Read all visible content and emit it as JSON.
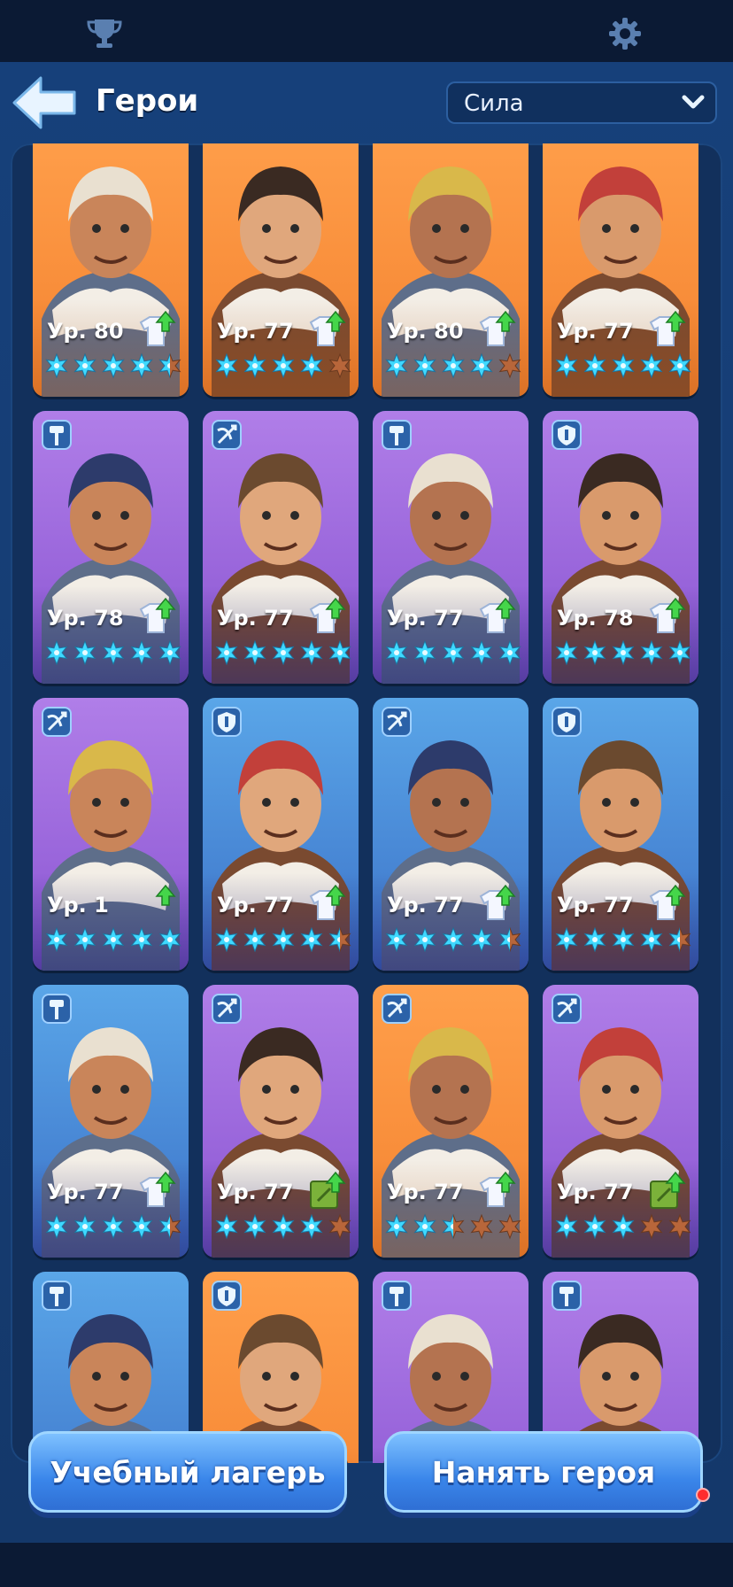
{
  "nav": {
    "trophy_icon": "trophy-icon",
    "settings_icon": "gear-icon"
  },
  "header": {
    "title": "Герои",
    "back_icon": "back-arrow-icon"
  },
  "sort": {
    "selected": "Сила",
    "icon": "chevron-down-icon"
  },
  "roles": {
    "melee": "hammer-icon",
    "ranged": "crossbow-icon",
    "tank": "shield-icon"
  },
  "colors": {
    "orange": "#f48330",
    "purple": "#8a55d2",
    "blue": "#3c72c8",
    "star_active": "#3fd9ff",
    "star_inactive": "#b8663a",
    "accent": "#3a86ea"
  },
  "heroes": [
    {
      "level": "Ур. 80",
      "frame": "orange",
      "role": "",
      "stars_filled": 4.5,
      "upgrade": "shirt"
    },
    {
      "level": "Ур. 77",
      "frame": "orange",
      "role": "",
      "stars_filled": 4,
      "upgrade": "shirt"
    },
    {
      "level": "Ур. 80",
      "frame": "orange",
      "role": "",
      "stars_filled": 4,
      "upgrade": "shirt"
    },
    {
      "level": "Ур. 77",
      "frame": "orange",
      "role": "",
      "stars_filled": 5,
      "upgrade": "shirt"
    },
    {
      "level": "Ур. 78",
      "frame": "purple",
      "role": "melee",
      "stars_filled": 5,
      "upgrade": "shirt"
    },
    {
      "level": "Ур. 77",
      "frame": "purple",
      "role": "ranged",
      "stars_filled": 5,
      "upgrade": "shirt"
    },
    {
      "level": "Ур. 77",
      "frame": "purple",
      "role": "melee",
      "stars_filled": 5,
      "upgrade": "shirt"
    },
    {
      "level": "Ур. 78",
      "frame": "purple",
      "role": "tank",
      "stars_filled": 5,
      "upgrade": "shirt"
    },
    {
      "level": "Ур. 1",
      "frame": "purple",
      "role": "ranged",
      "stars_filled": 5,
      "upgrade": "arrow"
    },
    {
      "level": "Ур. 77",
      "frame": "blue",
      "role": "tank",
      "stars_filled": 4.5,
      "upgrade": "shirt"
    },
    {
      "level": "Ур. 77",
      "frame": "blue",
      "role": "ranged",
      "stars_filled": 4.5,
      "upgrade": "shirt"
    },
    {
      "level": "Ур. 77",
      "frame": "blue",
      "role": "tank",
      "stars_filled": 4.5,
      "upgrade": "shirt"
    },
    {
      "level": "Ур. 77",
      "frame": "blue",
      "role": "melee",
      "stars_filled": 4.5,
      "upgrade": "shirt"
    },
    {
      "level": "Ур. 77",
      "frame": "purple",
      "role": "ranged",
      "stars_filled": 4,
      "upgrade": "book"
    },
    {
      "level": "Ур. 77",
      "frame": "orange",
      "role": "ranged",
      "stars_filled": 2.5,
      "upgrade": "shirt"
    },
    {
      "level": "Ур. 77",
      "frame": "purple",
      "role": "ranged",
      "stars_filled": 3,
      "upgrade": "book"
    },
    {
      "level": "",
      "frame": "blue",
      "role": "melee",
      "stars_filled": 0,
      "upgrade": ""
    },
    {
      "level": "",
      "frame": "orange",
      "role": "tank",
      "stars_filled": 0,
      "upgrade": ""
    },
    {
      "level": "",
      "frame": "purple",
      "role": "melee",
      "stars_filled": 0,
      "upgrade": ""
    },
    {
      "level": "",
      "frame": "purple",
      "role": "melee",
      "stars_filled": 0,
      "upgrade": ""
    }
  ],
  "buttons": {
    "training_camp": "Учебный лагерь",
    "hire_hero": "Нанять героя"
  }
}
